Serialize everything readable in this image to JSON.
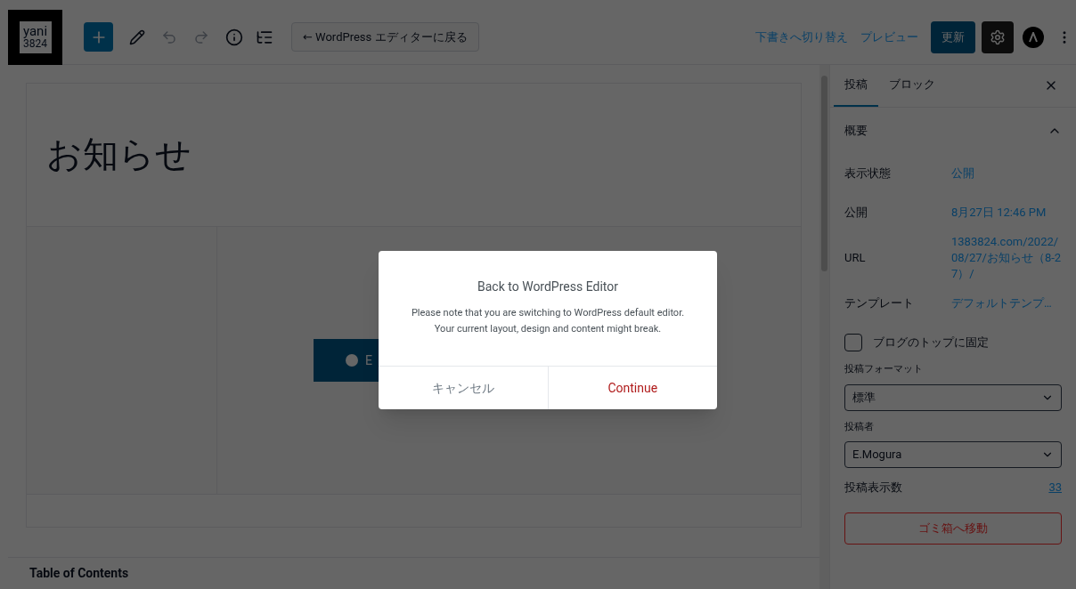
{
  "toolbar": {
    "logo": [
      "yani",
      "3824"
    ],
    "back_button": "← WordPress エディターに戻る",
    "switch_draft": "下書きへ切り替え",
    "preview": "プレビュー",
    "update": "更新"
  },
  "editor": {
    "title": "お知らせ",
    "elementor_button": "E",
    "toc_title": "Table of Contents"
  },
  "sidebar": {
    "tabs": [
      {
        "label": "投稿",
        "selected": true
      },
      {
        "label": "ブロック",
        "selected": false
      }
    ],
    "section": {
      "title": "概要",
      "expanded": true
    },
    "rows": [
      {
        "label": "表示状態",
        "value": "公開"
      },
      {
        "label": "公開",
        "value": "8月27日 12:46 PM"
      },
      {
        "label": "URL",
        "value": "1383824.com/2022/08/27/お知らせ（8-27）/"
      },
      {
        "label": "テンプレート",
        "value": "デフォルトテンプ…"
      }
    ],
    "sticky": {
      "label": "ブログのトップに固定",
      "checked": false
    },
    "format": {
      "label": "投稿フォーマット",
      "value": "標準"
    },
    "author": {
      "label": "投稿者",
      "value": "E.Mogura"
    },
    "views": {
      "label": "投稿表示数",
      "value": "33"
    },
    "trash": "ゴミ箱へ移動"
  },
  "dialog": {
    "title": "Back to WordPress Editor",
    "message": "Please note that you are switching to WordPress default editor. Your current layout, design and content might break.",
    "cancel": "キャンセル",
    "confirm": "Continue"
  }
}
